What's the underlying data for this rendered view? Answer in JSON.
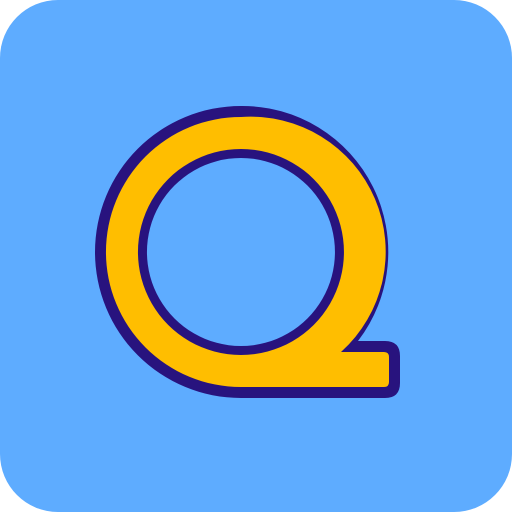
{
  "icon": {
    "name": "q-letter-logo",
    "colors": {
      "background": "#5eacff",
      "letter_fill": "#ffbe00",
      "letter_outline": "#28137e"
    }
  }
}
